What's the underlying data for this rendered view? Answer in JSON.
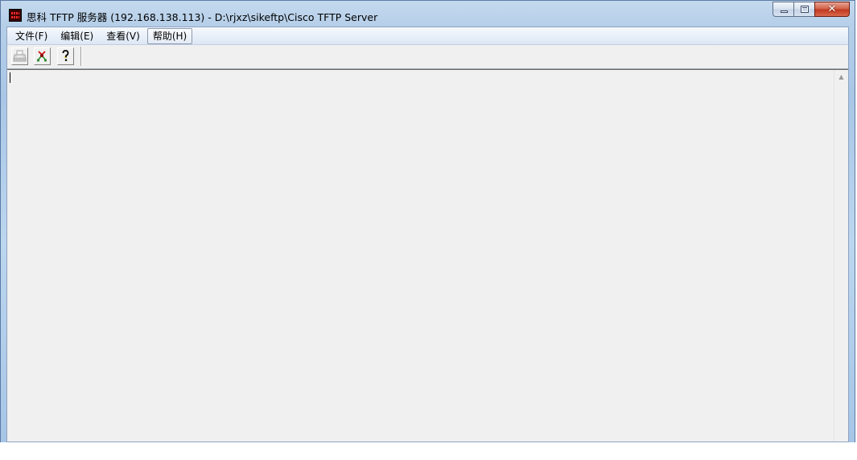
{
  "window": {
    "title": "思科 TFTP 服务器 (192.168.138.113) - D:\\rjxz\\sikeftp\\Cisco TFTP Server",
    "icon": "cisco-tftp-app-icon",
    "caption_buttons": {
      "minimize": "minimize-icon",
      "maximize": "maximize-icon",
      "close_glyph": "✕"
    }
  },
  "menu": {
    "items": [
      {
        "label": "文件(F)"
      },
      {
        "label": "编辑(E)"
      },
      {
        "label": "查看(V)"
      },
      {
        "label": "帮助(H)",
        "active": true
      }
    ]
  },
  "toolbar": {
    "buttons": [
      {
        "icon": "print-icon",
        "enabled": false
      },
      {
        "icon": "options-icon",
        "enabled": true
      },
      {
        "icon": "help-icon",
        "enabled": true
      }
    ]
  },
  "content": {
    "text": "",
    "scroll_up_glyph": "▲"
  },
  "colors": {
    "client_bg": "#f0f0f0",
    "close_button": "#c0391f"
  }
}
